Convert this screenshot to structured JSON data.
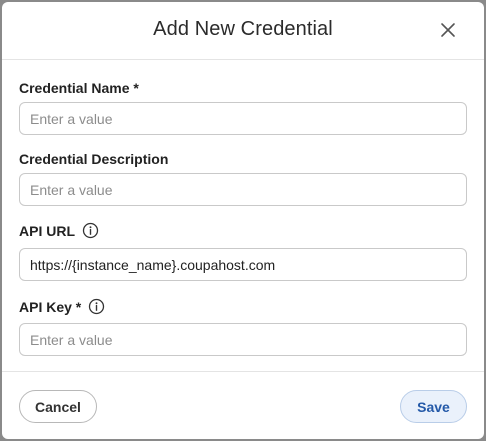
{
  "dialog": {
    "title": "Add New Credential"
  },
  "fields": {
    "name": {
      "label": "Credential Name *",
      "placeholder": "Enter a value",
      "value": ""
    },
    "description": {
      "label": "Credential Description",
      "placeholder": "Enter a value",
      "value": ""
    },
    "api_url": {
      "label": "API URL",
      "placeholder": "",
      "value": "https://{instance_name}.coupahost.com"
    },
    "api_key": {
      "label": "API Key *",
      "placeholder": "Enter a value",
      "value": ""
    }
  },
  "footer": {
    "cancel_label": "Cancel",
    "save_label": "Save"
  },
  "icons": {
    "close": "close-icon",
    "info": "info-icon"
  },
  "colors": {
    "primary": "#2459a8",
    "primary_bg": "#eaf1fb"
  }
}
